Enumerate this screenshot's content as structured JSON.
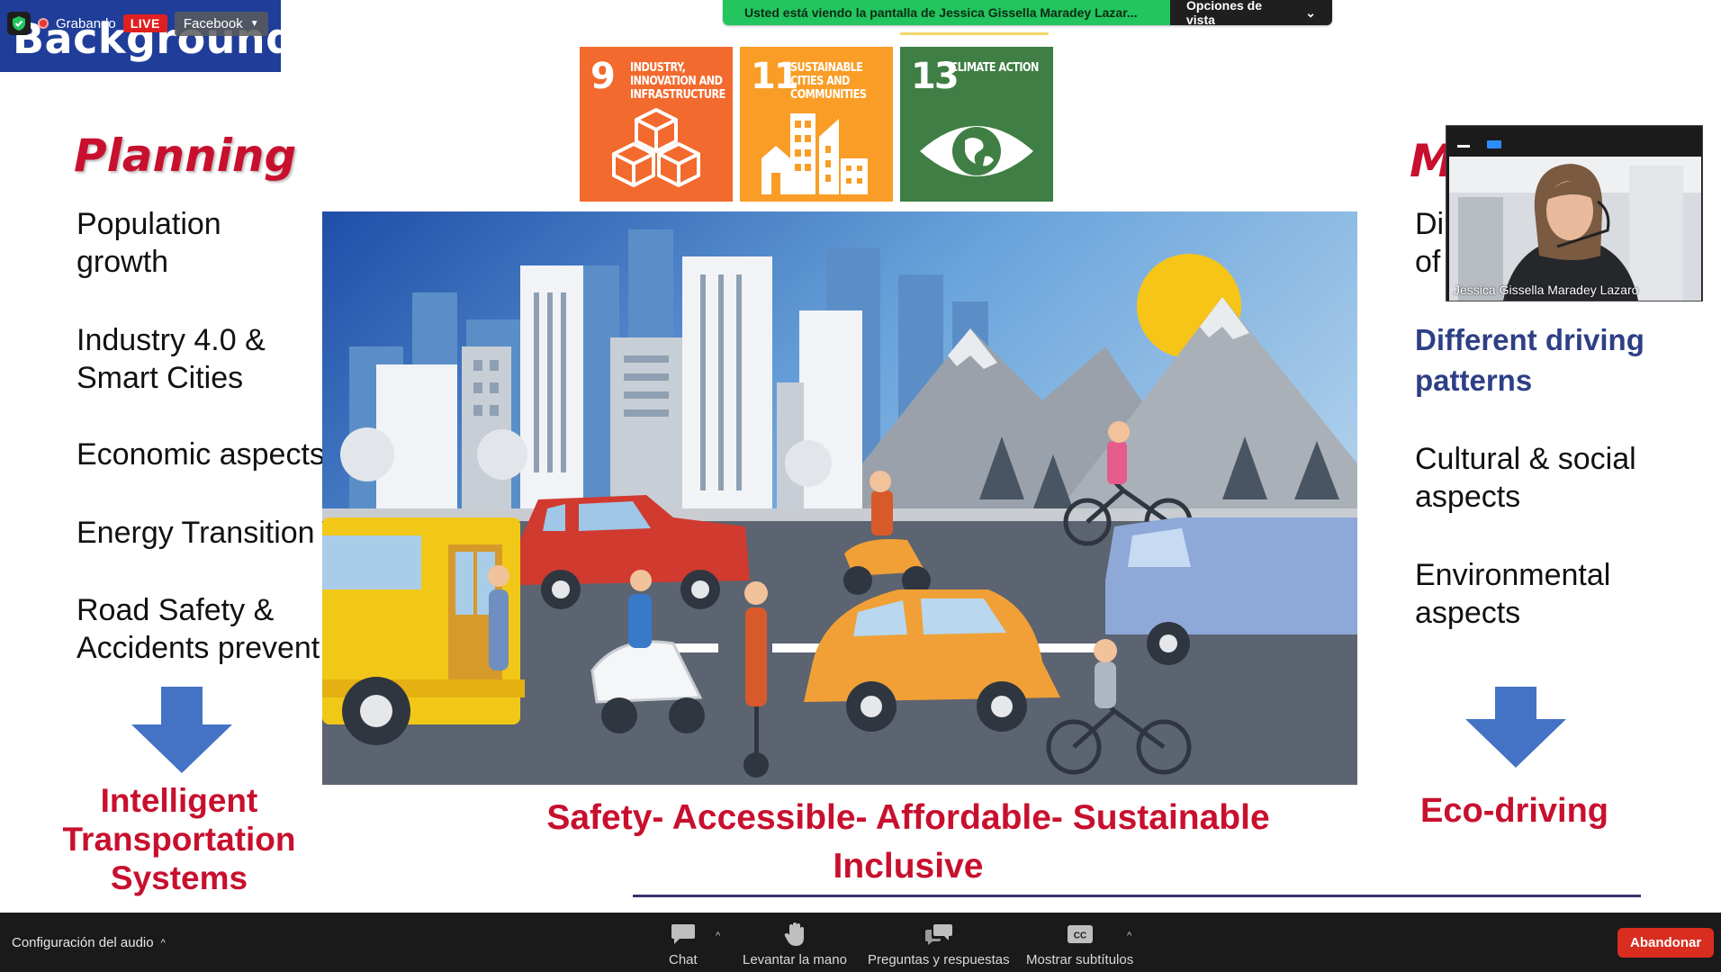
{
  "slide": {
    "title": "Background",
    "sdgs": [
      {
        "num": "9",
        "label": "Industry, innovation and infrastructure",
        "color": "#f26a2d"
      },
      {
        "num": "11",
        "label": "Sustainable cities and communities",
        "color": "#f99d26"
      },
      {
        "num": "13",
        "label": "Climate action",
        "color": "#3f7e44"
      }
    ],
    "left": {
      "heading": "Planning",
      "items": [
        "Population growth",
        "Industry 4.0 & Smart Cities",
        "Economic aspects",
        "Energy Transition",
        "Road Safety & Accidents prevent"
      ],
      "result": "Intelligent Transportation Systems"
    },
    "right": {
      "heading": "M",
      "partial_lines": [
        "Di",
        "of"
      ],
      "items": [
        "Different driving patterns",
        "Cultural & social aspects",
        "Environmental aspects"
      ],
      "result": "Eco-driving"
    },
    "tagline_line1": "Safety- Accessible- Affordable- Sustainable",
    "tagline_line2": "Inclusive",
    "colors": {
      "accent_red": "#c8102e",
      "title_blue": "#1f3d99",
      "arrow_blue": "#4472c4",
      "bullet_blue": "#2e3f85"
    }
  },
  "recording": {
    "status": "Grabando",
    "live": "LIVE",
    "platform": "Facebook"
  },
  "banner": {
    "message": "Usted está viendo la pantalla de Jessica Gissella Maradey Lazar...",
    "options": "Opciones de vista",
    "color": "#22c55e"
  },
  "video": {
    "participant": "Jessica Gissella Maradey Lazaro"
  },
  "toolbar": {
    "audio": "Configuración del audio",
    "chat": "Chat",
    "raise_hand": "Levantar la mano",
    "qa": "Preguntas y respuestas",
    "captions": "Mostrar subtítulos",
    "leave": "Abandonar",
    "leave_color": "#d92d20"
  }
}
